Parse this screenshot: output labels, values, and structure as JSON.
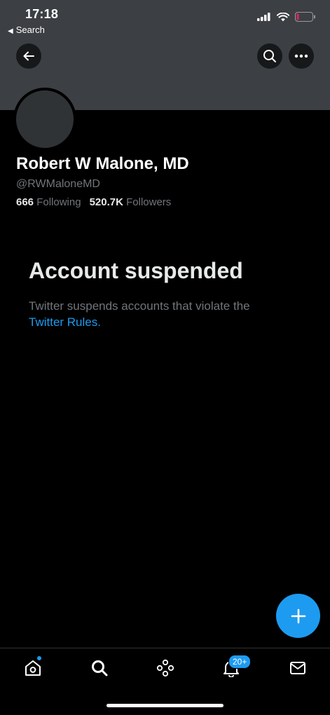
{
  "status_bar": {
    "time": "17:18",
    "back_label": "Search"
  },
  "profile": {
    "name": "Robert W Malone, MD",
    "handle": "@RWMaloneMD",
    "following_count": "666",
    "following_label": "Following",
    "followers_count": "520.7K",
    "followers_label": "Followers"
  },
  "notice": {
    "title": "Account suspended",
    "text": "Twitter suspends accounts that violate the",
    "link": "Twitter Rules."
  },
  "tabbar": {
    "notifications_badge": "20+"
  },
  "colors": {
    "accent": "#1d9bf0",
    "banner": "#3c3f43",
    "muted": "#71767b",
    "battery_low": "#e0245e"
  },
  "icons": [
    "back-arrow-icon",
    "search-icon",
    "more-icon",
    "compose-plus-icon",
    "home-icon",
    "explore-search-icon",
    "spaces-icon",
    "bell-icon",
    "mail-icon"
  ]
}
